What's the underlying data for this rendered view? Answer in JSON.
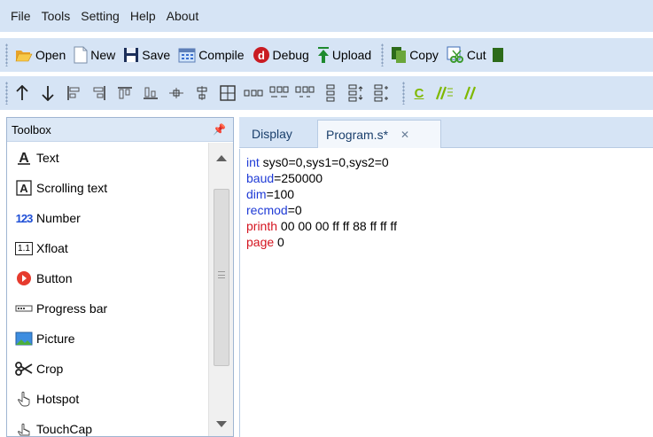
{
  "menu": [
    "File",
    "Tools",
    "Setting",
    "Help",
    "About"
  ],
  "toolbar1": [
    {
      "label": "Open",
      "icon": "folder-open-icon"
    },
    {
      "label": "New",
      "icon": "new-file-icon"
    },
    {
      "label": "Save",
      "icon": "save-icon"
    },
    {
      "label": "Compile",
      "icon": "compile-icon"
    },
    {
      "label": "Debug",
      "icon": "debug-icon"
    },
    {
      "label": "Upload",
      "icon": "upload-icon"
    },
    {
      "label": "Copy",
      "icon": "copy-icon"
    },
    {
      "label": "Cut",
      "icon": "cut-icon"
    }
  ],
  "toolbar2": {
    "icons": [
      "arrow-up-icon",
      "arrow-down-icon",
      "align-left-icon",
      "align-right-icon",
      "align-top-icon",
      "align-bottom-icon",
      "center-horizontal-icon",
      "center-vertical-icon",
      "size-icon",
      "distribute-horizontal-icon",
      "hspace-increase-icon",
      "hspace-decrease-icon",
      "distribute-vertical-icon",
      "vspace-increase-icon",
      "vspace-decrease-icon"
    ],
    "text_c": "C",
    "accent": "#7fb800"
  },
  "toolbox": {
    "title": "Toolbox",
    "items": [
      {
        "label": "Text",
        "icon": "text-icon"
      },
      {
        "label": "Scrolling text",
        "icon": "scrolling-text-icon"
      },
      {
        "label": "Number",
        "icon": "number-icon"
      },
      {
        "label": "Xfloat",
        "icon": "xfloat-icon"
      },
      {
        "label": "Button",
        "icon": "button-icon"
      },
      {
        "label": "Progress bar",
        "icon": "progress-bar-icon"
      },
      {
        "label": "Picture",
        "icon": "picture-icon"
      },
      {
        "label": "Crop",
        "icon": "crop-icon"
      },
      {
        "label": "Hotspot",
        "icon": "hotspot-icon"
      },
      {
        "label": "TouchCap",
        "icon": "touchcap-icon"
      }
    ],
    "icon_glyphs": {
      "number": "123",
      "xfloat": "1.1"
    }
  },
  "tabs": [
    {
      "label": "Display",
      "active": false
    },
    {
      "label": "Program.s*",
      "active": true
    }
  ],
  "colors": {
    "keyword_blue": "#1f3bd6",
    "keyword_red": "#d4141f",
    "chrome": "#d6e4f5"
  },
  "code_lines": [
    {
      "kw": "int",
      "kw_color": "blue",
      "rest": " sys0=0,sys1=0,sys2=0"
    },
    {
      "kw": "baud",
      "kw_color": "blue",
      "rest": "=250000"
    },
    {
      "kw": "dim",
      "kw_color": "blue",
      "rest": "=100"
    },
    {
      "kw": "recmod",
      "kw_color": "blue",
      "rest": "=0"
    },
    {
      "kw": "printh",
      "kw_color": "red",
      "rest": " 00 00 00 ff ff 88 ff ff ff"
    },
    {
      "kw": "page",
      "kw_color": "red",
      "rest": " 0"
    }
  ]
}
